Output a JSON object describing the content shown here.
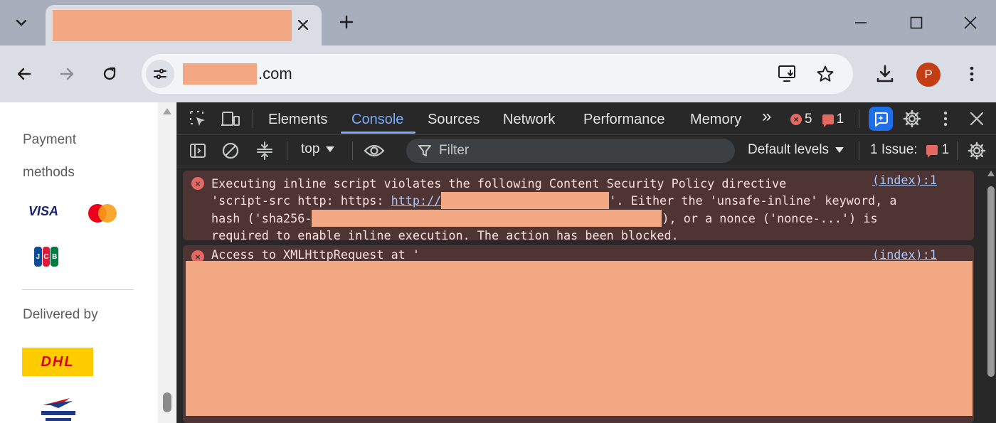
{
  "browser": {
    "tab": {
      "title": ""
    },
    "url": {
      "redacted_host": "",
      "tld": ".com"
    },
    "profile_initial": "P"
  },
  "page": {
    "payment_heading": "Payment methods",
    "payment_logos": [
      "VISA",
      "mastercard",
      "JCB"
    ],
    "visa_label": "VISA",
    "delivered_by": "Delivered by",
    "dhl_label": "DHL"
  },
  "devtools": {
    "tabs": [
      "Elements",
      "Console",
      "Sources",
      "Network",
      "Performance",
      "Memory"
    ],
    "active_tab": "Console",
    "more_tabs_icon": "»",
    "error_count": "5",
    "issue_count": "1",
    "context": "top",
    "filter_placeholder": "Filter",
    "levels_label": "Default levels",
    "issues_label": "1 Issue:",
    "issues_badge_count": "1"
  },
  "console": {
    "messages": [
      {
        "level": "error",
        "source": "(index):1",
        "line1": "Executing inline script violates the following Content Security Policy directive",
        "line2_prefix": "'script-src http: https: ",
        "line2_link": "http://",
        "line2_suffix": "'. Either the 'unsafe-inline' keyword, a",
        "line3_prefix": "hash ('sha256-",
        "line3_suffix": "), or a nonce ('nonce-...') is",
        "line4": "required to enable inline execution. The action has been blocked."
      },
      {
        "level": "error",
        "source": "(index):1",
        "line1": "Access to XMLHttpRequest at '"
      }
    ]
  },
  "colors": {
    "redaction": "#f1a883",
    "devtools_bg": "#282828",
    "error_row_bg": "#4e3534",
    "accent_blue": "#7cacf8",
    "error_red": "#e46962"
  }
}
